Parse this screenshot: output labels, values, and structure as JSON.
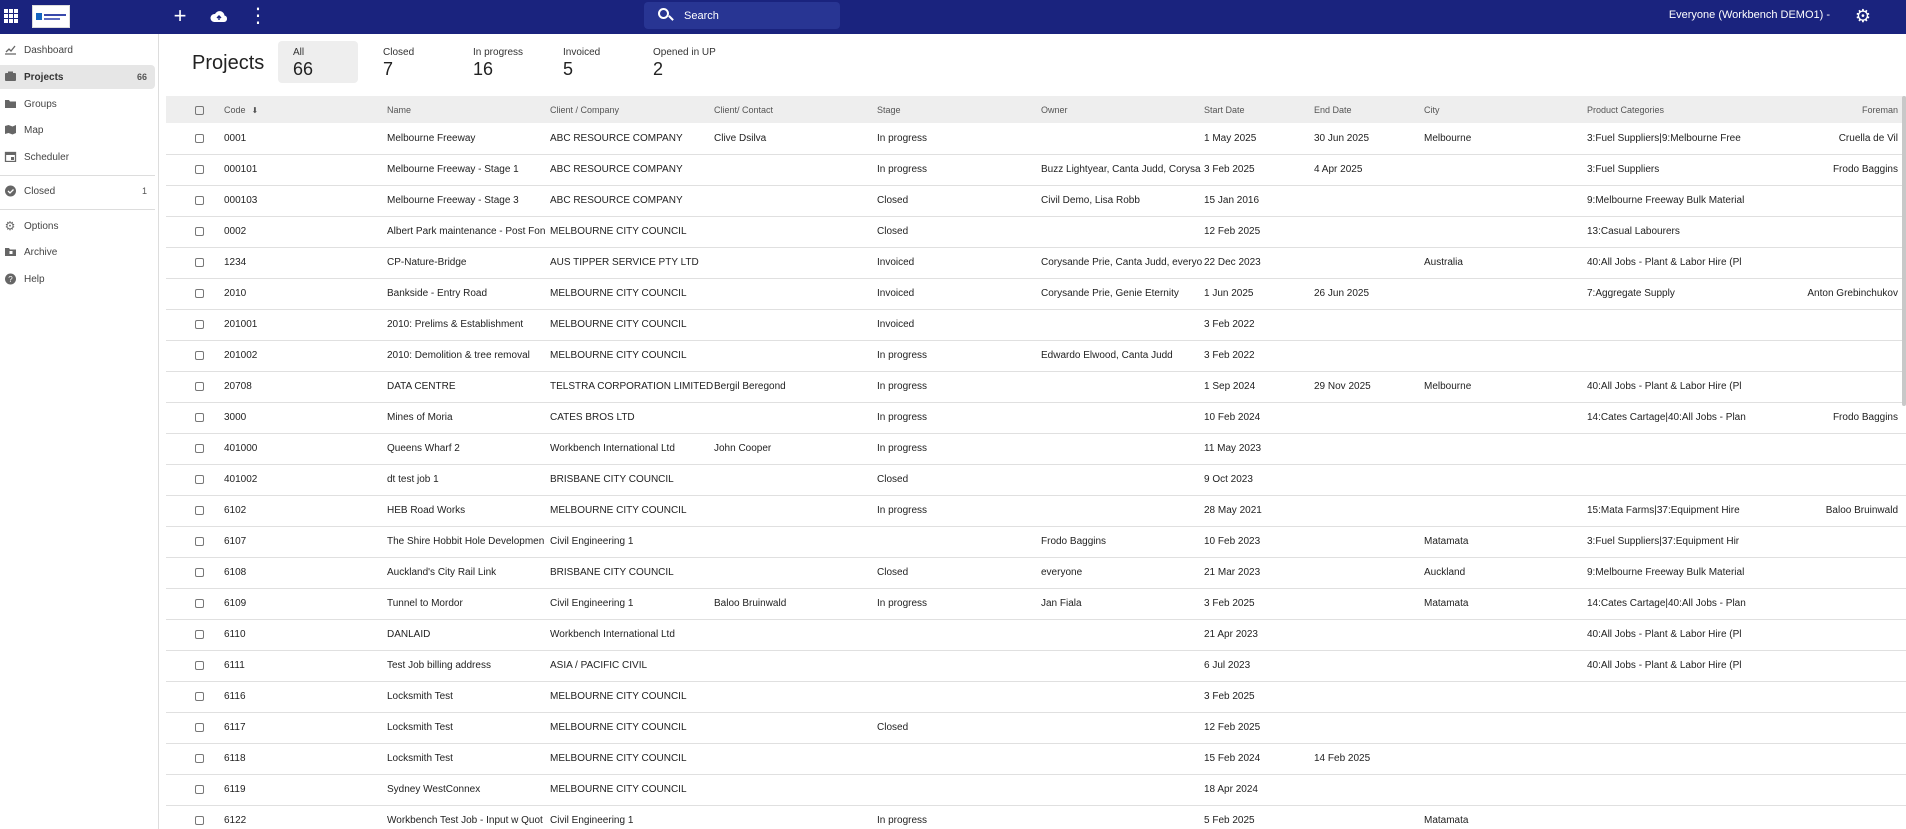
{
  "topbar": {
    "search_placeholder": "Search",
    "user_label": "Everyone (Workbench DEMO1) -",
    "icons": [
      "apps-icon",
      "plus-icon",
      "cloud-upload-icon",
      "more-vert-icon",
      "search-icon",
      "gear-icon"
    ],
    "background": "#1a237e"
  },
  "sidebar": {
    "items": [
      {
        "label": "Dashboard",
        "icon": "chart-icon",
        "count": ""
      },
      {
        "label": "Projects",
        "icon": "projects-icon",
        "count": "66"
      },
      {
        "label": "Groups",
        "icon": "folder-icon",
        "count": ""
      },
      {
        "label": "Map",
        "icon": "map-icon",
        "count": ""
      },
      {
        "label": "Scheduler",
        "icon": "calendar-icon",
        "count": ""
      },
      {
        "label": "Closed",
        "icon": "check-circle-icon",
        "count": "1"
      },
      {
        "label": "Options",
        "icon": "gear-icon",
        "count": ""
      },
      {
        "label": "Archive",
        "icon": "archive-icon",
        "count": ""
      },
      {
        "label": "Help",
        "icon": "help-icon",
        "count": ""
      }
    ]
  },
  "header": {
    "title": "Projects",
    "tabs": [
      {
        "label": "All",
        "count": "66"
      },
      {
        "label": "Closed",
        "count": "7"
      },
      {
        "label": "In progress",
        "count": "16"
      },
      {
        "label": "Invoiced",
        "count": "5"
      },
      {
        "label": "Opened in UP",
        "count": "2"
      }
    ]
  },
  "table": {
    "columns": [
      "Code",
      "Name",
      "Client / Company",
      "Client/ Contact",
      "Stage",
      "Owner",
      "Start Date",
      "End Date",
      "City",
      "Product Categories",
      "Foreman"
    ],
    "rows": [
      [
        "0001",
        "Melbourne Freeway",
        "ABC RESOURCE COMPANY",
        "Clive Dsilva",
        "In progress",
        "",
        "1 May 2025",
        "30 Jun 2025",
        "Melbourne",
        "3:Fuel Suppliers|9:Melbourne Free",
        "Cruella de Vil"
      ],
      [
        "000101",
        "Melbourne Freeway - Stage 1",
        "ABC RESOURCE COMPANY",
        "",
        "In progress",
        "Buzz Lightyear, Canta Judd, Corysa",
        "3 Feb 2025",
        "4 Apr 2025",
        "",
        "3:Fuel Suppliers",
        "Frodo Baggins"
      ],
      [
        "000103",
        "Melbourne Freeway - Stage 3",
        "ABC RESOURCE COMPANY",
        "",
        "Closed",
        "Civil Demo, Lisa Robb",
        "15 Jan 2016",
        "",
        "",
        "9:Melbourne Freeway Bulk Material",
        ""
      ],
      [
        "0002",
        "Albert Park maintenance - Post Fon",
        "MELBOURNE CITY COUNCIL",
        "",
        "Closed",
        "",
        "12 Feb 2025",
        "",
        "",
        "13:Casual Labourers",
        ""
      ],
      [
        "1234",
        "CP-Nature-Bridge",
        "AUS TIPPER SERVICE PTY LTD",
        "",
        "Invoiced",
        "Corysande Prie, Canta Judd, everyo",
        "22 Dec 2023",
        "",
        "Australia",
        "40:All Jobs - Plant & Labor Hire (Pl",
        ""
      ],
      [
        "2010",
        "Bankside - Entry Road",
        "MELBOURNE CITY COUNCIL",
        "",
        "Invoiced",
        "Corysande Prie, Genie Eternity",
        "1 Jun 2025",
        "26 Jun 2025",
        "",
        "7:Aggregate Supply",
        "Anton Grebinchukov"
      ],
      [
        "201001",
        "2010: Prelims & Establishment",
        "MELBOURNE CITY COUNCIL",
        "",
        "Invoiced",
        "",
        "3 Feb 2022",
        "",
        "",
        "",
        ""
      ],
      [
        "201002",
        "2010: Demolition & tree removal",
        "MELBOURNE CITY COUNCIL",
        "",
        "In progress",
        "Edwardo Elwood, Canta Judd",
        "3 Feb 2022",
        "",
        "",
        "",
        ""
      ],
      [
        "20708",
        "DATA CENTRE",
        "TELSTRA CORPORATION LIMITED",
        "Bergil Beregond",
        "In progress",
        "",
        "1 Sep 2024",
        "29 Nov 2025",
        "Melbourne",
        "40:All Jobs - Plant & Labor Hire (Pl",
        ""
      ],
      [
        "3000",
        "Mines of Moria",
        "CATES BROS LTD",
        "",
        "In progress",
        "",
        "10 Feb 2024",
        "",
        "",
        "14:Cates Cartage|40:All Jobs - Plan",
        "Frodo Baggins"
      ],
      [
        "401000",
        "Queens Wharf 2",
        "Workbench International Ltd",
        "John Cooper",
        "In progress",
        "",
        "11 May 2023",
        "",
        "",
        "",
        ""
      ],
      [
        "401002",
        "dt test job 1",
        "BRISBANE CITY COUNCIL",
        "",
        "Closed",
        "",
        "9 Oct 2023",
        "",
        "",
        "",
        ""
      ],
      [
        "6102",
        "HEB Road Works",
        "MELBOURNE CITY COUNCIL",
        "",
        "In progress",
        "",
        "28 May 2021",
        "",
        "",
        "15:Mata Farms|37:Equipment Hire",
        "Baloo Bruinwald"
      ],
      [
        "6107",
        "The Shire Hobbit Hole Developmen",
        "Civil Engineering 1",
        "",
        "",
        "Frodo Baggins",
        "10 Feb 2023",
        "",
        "Matamata",
        "3:Fuel Suppliers|37:Equipment Hir",
        ""
      ],
      [
        "6108",
        "Auckland's City Rail Link",
        "BRISBANE CITY COUNCIL",
        "",
        "Closed",
        "everyone",
        "21 Mar 2023",
        "",
        "Auckland",
        "9:Melbourne Freeway Bulk Material",
        ""
      ],
      [
        "6109",
        "Tunnel to Mordor",
        "Civil Engineering 1",
        "Baloo Bruinwald",
        "In progress",
        "Jan Fiala",
        "3 Feb 2025",
        "",
        "Matamata",
        "14:Cates Cartage|40:All Jobs - Plan",
        ""
      ],
      [
        "6110",
        "DANLAID",
        "Workbench International Ltd",
        "",
        "",
        "",
        "21 Apr 2023",
        "",
        "",
        "40:All Jobs - Plant & Labor Hire (Pl",
        ""
      ],
      [
        "6111",
        "Test Job billing address",
        "ASIA / PACIFIC CIVIL",
        "",
        "",
        "",
        "6 Jul 2023",
        "",
        "",
        "40:All Jobs - Plant & Labor Hire (Pl",
        ""
      ],
      [
        "6116",
        "Locksmith Test",
        "MELBOURNE CITY COUNCIL",
        "",
        "",
        "",
        "3 Feb 2025",
        "",
        "",
        "",
        ""
      ],
      [
        "6117",
        "Locksmith Test",
        "MELBOURNE CITY COUNCIL",
        "",
        "Closed",
        "",
        "12 Feb 2025",
        "",
        "",
        "",
        ""
      ],
      [
        "6118",
        "Locksmith Test",
        "MELBOURNE CITY COUNCIL",
        "",
        "",
        "",
        "15 Feb 2024",
        "14 Feb 2025",
        "",
        "",
        ""
      ],
      [
        "6119",
        "Sydney WestConnex",
        "MELBOURNE CITY COUNCIL",
        "",
        "",
        "",
        "18 Apr 2024",
        "",
        "",
        "",
        ""
      ],
      [
        "6122",
        "Workbench Test Job - Input w Quot",
        "Civil Engineering 1",
        "",
        "In progress",
        "",
        "5 Feb 2025",
        "",
        "Matamata",
        "",
        ""
      ]
    ]
  }
}
